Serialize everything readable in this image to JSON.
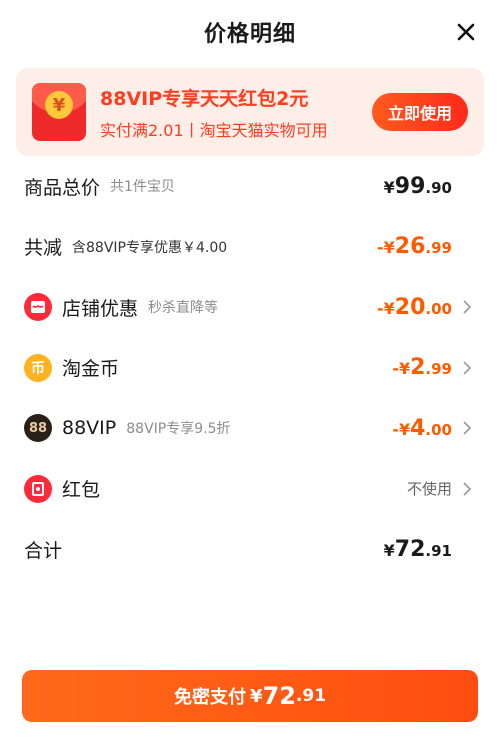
{
  "header": {
    "title": "价格明细"
  },
  "banner": {
    "title": "88VIP专享天天红包2元",
    "subtitle": "实付满2.01丨淘宝天猫实物可用",
    "button_label": "立即使用",
    "coin_symbol": "¥"
  },
  "rows": {
    "total": {
      "label": "商品总价",
      "desc": "共1件宝贝",
      "sign": "¥",
      "int": "99",
      "dec": ".90"
    },
    "reduce": {
      "label": "共减",
      "desc": "含88VIP专享优惠￥4.00",
      "sign": "-¥",
      "int": "26",
      "dec": ".99"
    },
    "shop": {
      "label": "店铺优惠",
      "desc": "秒杀直降等",
      "sign": "-¥",
      "int": "20",
      "dec": ".00"
    },
    "coin": {
      "label": "淘金币",
      "sign": "-¥",
      "int": "2",
      "dec": ".99",
      "icon_text": "币"
    },
    "vip": {
      "label": "88VIP",
      "desc": "88VIP专享9.5折",
      "sign": "-¥",
      "int": "4",
      "dec": ".00",
      "icon_text": "88"
    },
    "redpack": {
      "label": "红包",
      "value": "不使用"
    },
    "sum": {
      "label": "合计",
      "sign": "¥",
      "int": "72",
      "dec": ".91"
    }
  },
  "pay": {
    "label": "免密支付",
    "sign": "¥",
    "int": "72",
    "dec": ".91"
  },
  "colors": {
    "accent": "#ff5a00",
    "banner_bg": "#fdeee8",
    "red": "#ef2a2a"
  }
}
